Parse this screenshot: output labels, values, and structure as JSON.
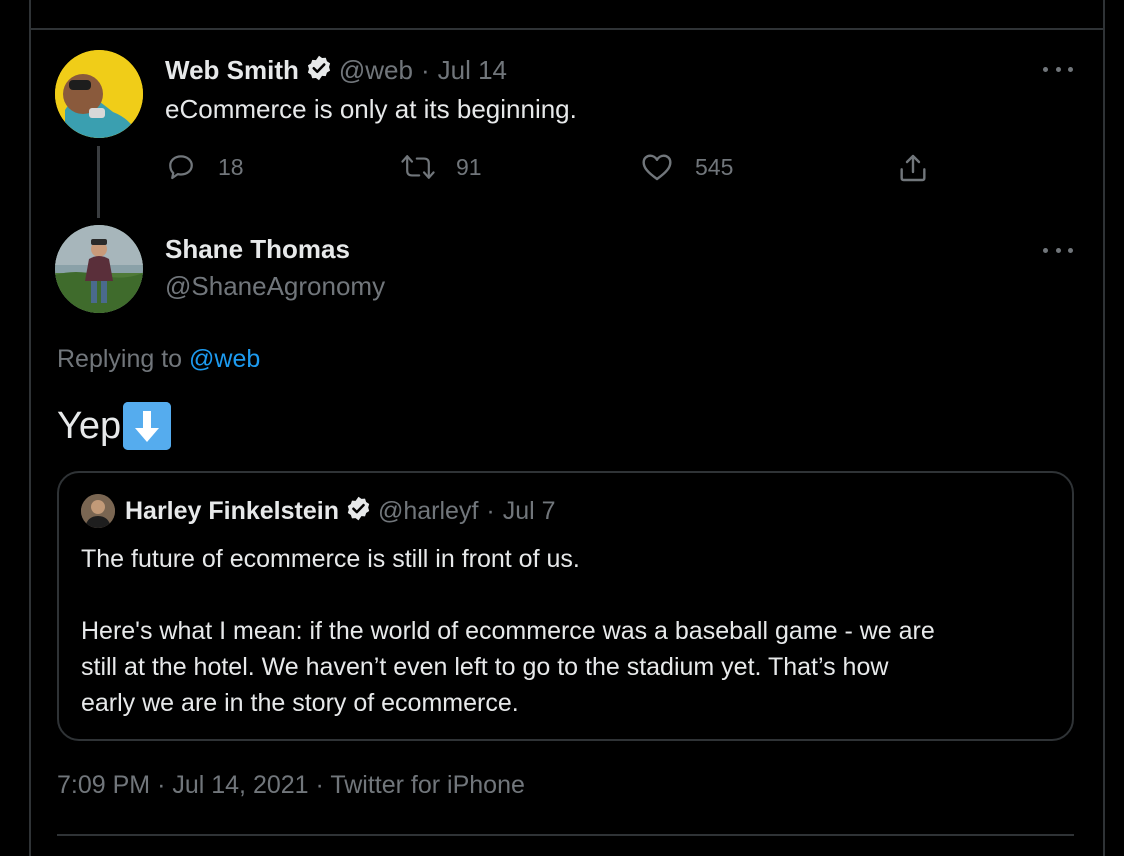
{
  "parent_tweet": {
    "name": "Web Smith",
    "handle": "@web",
    "separator": "·",
    "date": "Jul 14",
    "text": "eCommerce is only at its beginning.",
    "replies": "18",
    "retweets": "91",
    "likes": "545"
  },
  "reply_tweet": {
    "name": "Shane Thomas",
    "handle": "@ShaneAgronomy",
    "replying_label": "Replying to",
    "replying_handle": "@web",
    "text": "Yep",
    "emoji": "down-arrow-emoji"
  },
  "quoted_tweet": {
    "name": "Harley Finkelstein",
    "handle": "@harleyf",
    "separator": "·",
    "date": "Jul 7",
    "line1": "The future of ecommerce is still in front of us.",
    "line2": "Here's what I mean: if the world of ecommerce was a baseball game - we are",
    "line3": "still at the hotel. We haven’t even left to go to the stadium yet. That’s how",
    "line4": "early we are in the story of ecommerce."
  },
  "footer": {
    "time": "7:09 PM",
    "separator": "·",
    "date": "Jul 14, 2021",
    "source": "Twitter for iPhone"
  },
  "icons": {
    "reply": "reply-icon",
    "retweet": "retweet-icon",
    "like": "heart-icon",
    "share": "share-icon",
    "more": "more-icon",
    "verified": "verified-badge-icon"
  },
  "colors": {
    "background": "#000000",
    "text": "#e7e9ea",
    "muted": "#71767b",
    "link": "#1d9bf0",
    "border": "#2f3336"
  }
}
